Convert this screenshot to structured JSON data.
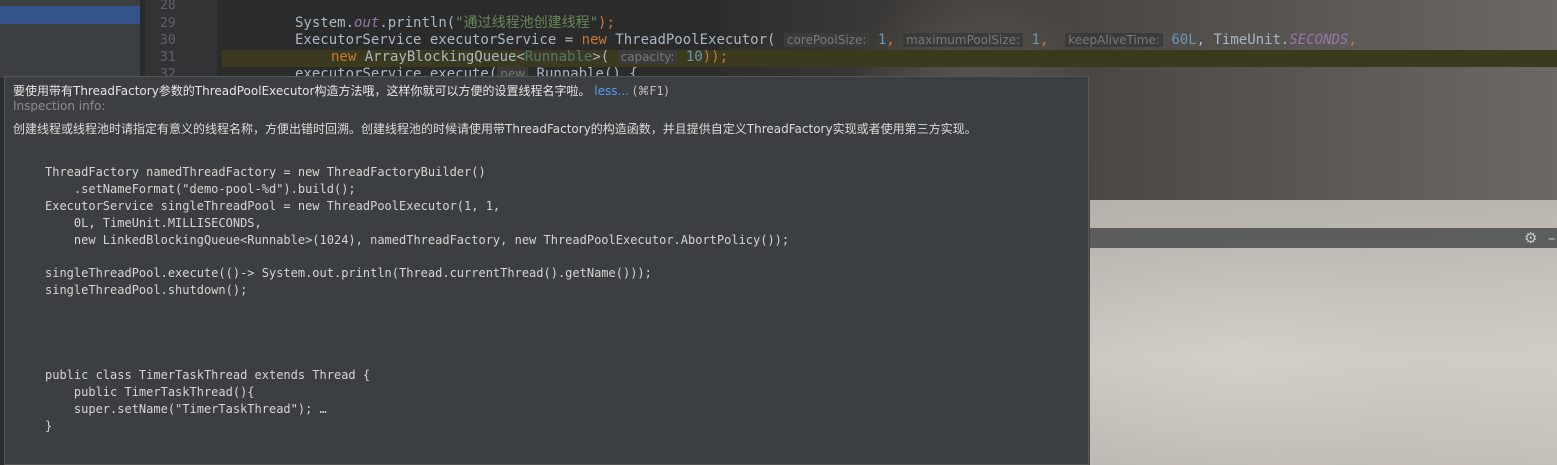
{
  "editor": {
    "line_numbers": [
      "28",
      "29",
      "30",
      "31",
      "32"
    ],
    "lines": {
      "l29": {
        "print_obj": "System.",
        "print_field": "out",
        "print_call": ".println(",
        "print_string": "\"通过线程池创建线程\"",
        "print_end": ");"
      },
      "l30": {
        "decl": "ExecutorService executorService = ",
        "new_kw": "new",
        "cls": " ThreadPoolExecutor( ",
        "hint1": "corePoolSize:",
        "val1": " 1",
        "sep1": ", ",
        "hint2": "maximumPoolSize:",
        "val2": " 1",
        "sep2": ",  ",
        "hint3": "keepAliveTime:",
        "val3": " 60L",
        "sep3": ", TimeUnit.",
        "const": "SECONDS",
        "sep4": ","
      },
      "l31": {
        "new_kw": "new",
        "cls": " ArrayBlockingQueue<",
        "gen": "Runnable",
        "cls2": ">( ",
        "hint": "capacity:",
        "val": " 10",
        "end": "));"
      },
      "l32": {
        "text": "executorService.execute(",
        "hint": "new",
        "text2": " Runnable() {"
      }
    }
  },
  "popup": {
    "title": "要使用带有ThreadFactory参数的ThreadPoolExecutor构造方法哦，这样你就可以方便的设置线程名字啦。",
    "less_link": "less...",
    "shortcut": "(⌘F1)",
    "subtitle": "Inspection info:",
    "description": "创建线程或线程池时请指定有意义的线程名称，方便出错时回溯。创建线程池的时候请使用带ThreadFactory的构造函数，并且提供自定义ThreadFactory实现或者使用第三方实现。",
    "code": "ThreadFactory namedThreadFactory = new ThreadFactoryBuilder()\n    .setNameFormat(\"demo-pool-%d\").build();\nExecutorService singleThreadPool = new ThreadPoolExecutor(1, 1,\n    0L, TimeUnit.MILLISECONDS,\n    new LinkedBlockingQueue<Runnable>(1024), namedThreadFactory, new ThreadPoolExecutor.AbortPolicy());\n\nsingleThreadPool.execute(()-> System.out.println(Thread.currentThread().getName()));\nsingleThreadPool.shutdown();\n\n\n\n\npublic class TimerTaskThread extends Thread {\n    public TimerTaskThread(){\n    super.setName(\"TimerTaskThread\"); …\n}"
  },
  "toolwindow": {
    "gear_icon": "⚙",
    "minimize_icon": "–"
  }
}
